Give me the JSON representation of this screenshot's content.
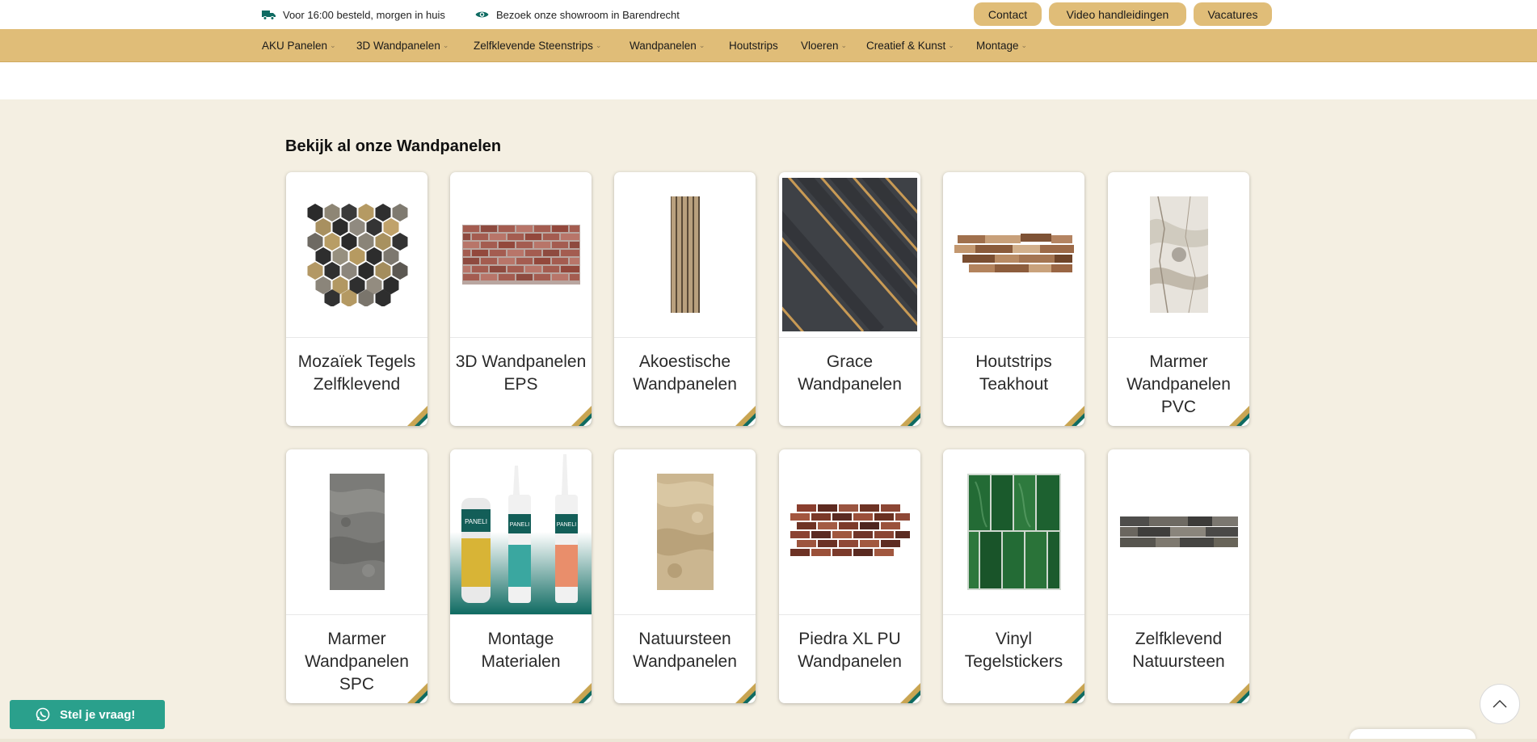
{
  "topbar": {
    "delivery_text": "Voor 16:00 besteld, morgen in huis",
    "delivery_icon": "truck-icon",
    "showroom_text": "Bezoek onze showroom in Barendrecht",
    "showroom_icon": "eye-icon",
    "buttons": [
      "Contact",
      "Video handleidingen",
      "Vacatures"
    ]
  },
  "nav": {
    "items": [
      {
        "label": "AKU Panelen",
        "dropdown": true
      },
      {
        "label": "3D Wandpanelen",
        "dropdown": true
      },
      {
        "label": "Zelfklevende Steenstrips",
        "dropdown": true
      },
      {
        "label": "Wandpanelen",
        "dropdown": true
      },
      {
        "label": "Houtstrips",
        "dropdown": false
      },
      {
        "label": "Vloeren",
        "dropdown": true
      },
      {
        "label": "Creatief & Kunst",
        "dropdown": true
      },
      {
        "label": "Montage",
        "dropdown": true
      }
    ]
  },
  "section": {
    "title": "Bekijk al onze Wandpanelen"
  },
  "cards": [
    {
      "label": "Mozaïek Tegels Zelfklevend"
    },
    {
      "label": "3D Wandpanelen EPS"
    },
    {
      "label": "Akoestische Wandpanelen"
    },
    {
      "label": "Grace Wandpanelen"
    },
    {
      "label": "Houtstrips Teakhout"
    },
    {
      "label": "Marmer Wandpanelen PVC"
    },
    {
      "label": "Marmer Wandpanelen SPC"
    },
    {
      "label": "Montage Materialen"
    },
    {
      "label": "Natuursteen Wandpanelen"
    },
    {
      "label": "Piedra XL PU Wandpanelen"
    },
    {
      "label": "Vinyl Tegelstickers"
    },
    {
      "label": "Zelfklevend Natuursteen"
    }
  ],
  "product_brand": "PANELI",
  "floating": {
    "ask_label": "Stel je vraag!",
    "ask_icon": "whatsapp-icon",
    "scroll_top_icon": "chevron-up-icon"
  },
  "colors": {
    "accent": "#e0bd78",
    "teal": "#0f6b62",
    "background": "#f4efe2",
    "whatsapp": "#2aa08c"
  }
}
